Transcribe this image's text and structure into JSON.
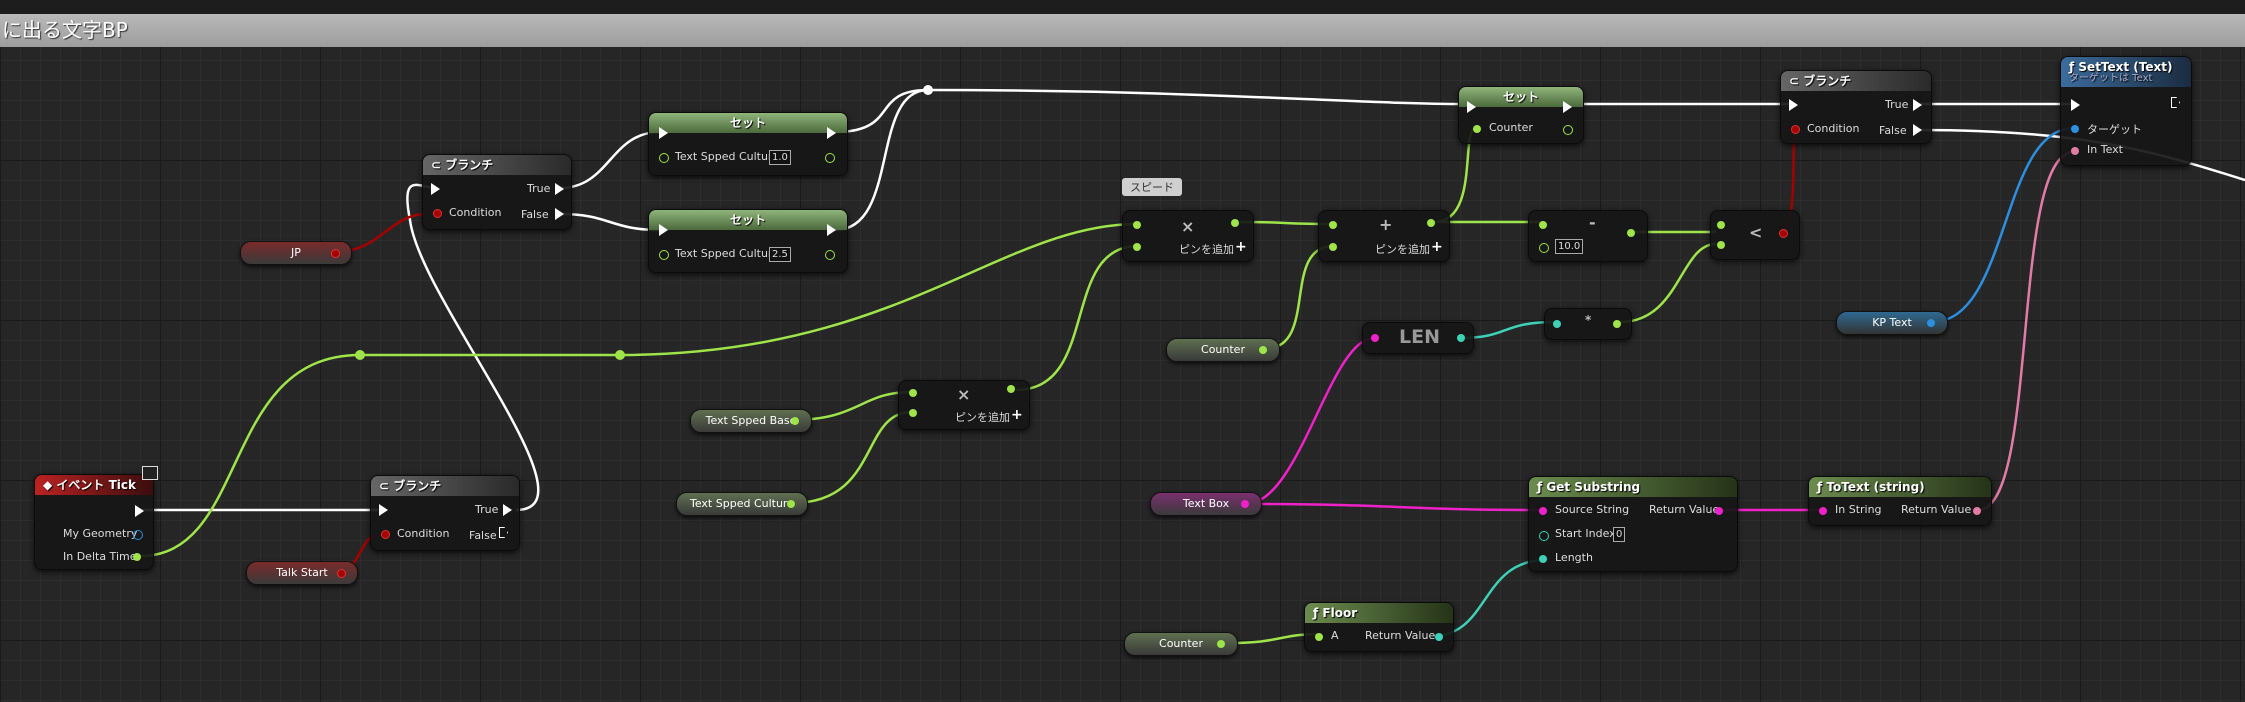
{
  "title": "に出る文字BP",
  "comment": "スピード",
  "add_pin_label": "ピンを追加",
  "branch_title": "ブランチ",
  "set_title": "セット",
  "pins": {
    "true": "True",
    "false": "False",
    "condition": "Condition",
    "counter": "Counter",
    "text_spped_culture": "Text Spped Culture",
    "my_geometry": "My Geometry",
    "in_delta_time": "In Delta Time",
    "target": "ターゲット",
    "in_text": "In Text",
    "source_string": "Source String",
    "return_value": "Return Value",
    "start_index": "Start Index",
    "length": "Length",
    "in_string": "In String",
    "a": "A"
  },
  "values": {
    "set_culture_1": "1.0",
    "set_culture_2": "2.5",
    "threshold": "10.0",
    "start_index": "0"
  },
  "operators": {
    "multiply": "×",
    "add": "+",
    "subtract": "-",
    "less": "<",
    "mult_small": "*",
    "len": "LEN"
  },
  "nodes": {
    "event_tick": "イベント Tick",
    "set_text": "SetText (Text)",
    "set_text_sub": "ターゲットは Text",
    "get_substring": "Get Substring",
    "to_text": "ToText (string)",
    "floor": "Floor"
  },
  "variables": {
    "jp": "JP",
    "talk_start": "Talk Start",
    "counter": "Counter",
    "text_spped_base": "Text Spped Base",
    "text_spped_culture": "Text Spped Culture",
    "text_box": "Text Box",
    "kp_text": "KP Text"
  },
  "colors": {
    "exec": "#ffffff",
    "float": "#9ee44a",
    "bool": "#a70000",
    "string": "#f021c8",
    "int": "#3ed1b8",
    "object": "#2d8fe0",
    "text": "#e27ca6"
  }
}
